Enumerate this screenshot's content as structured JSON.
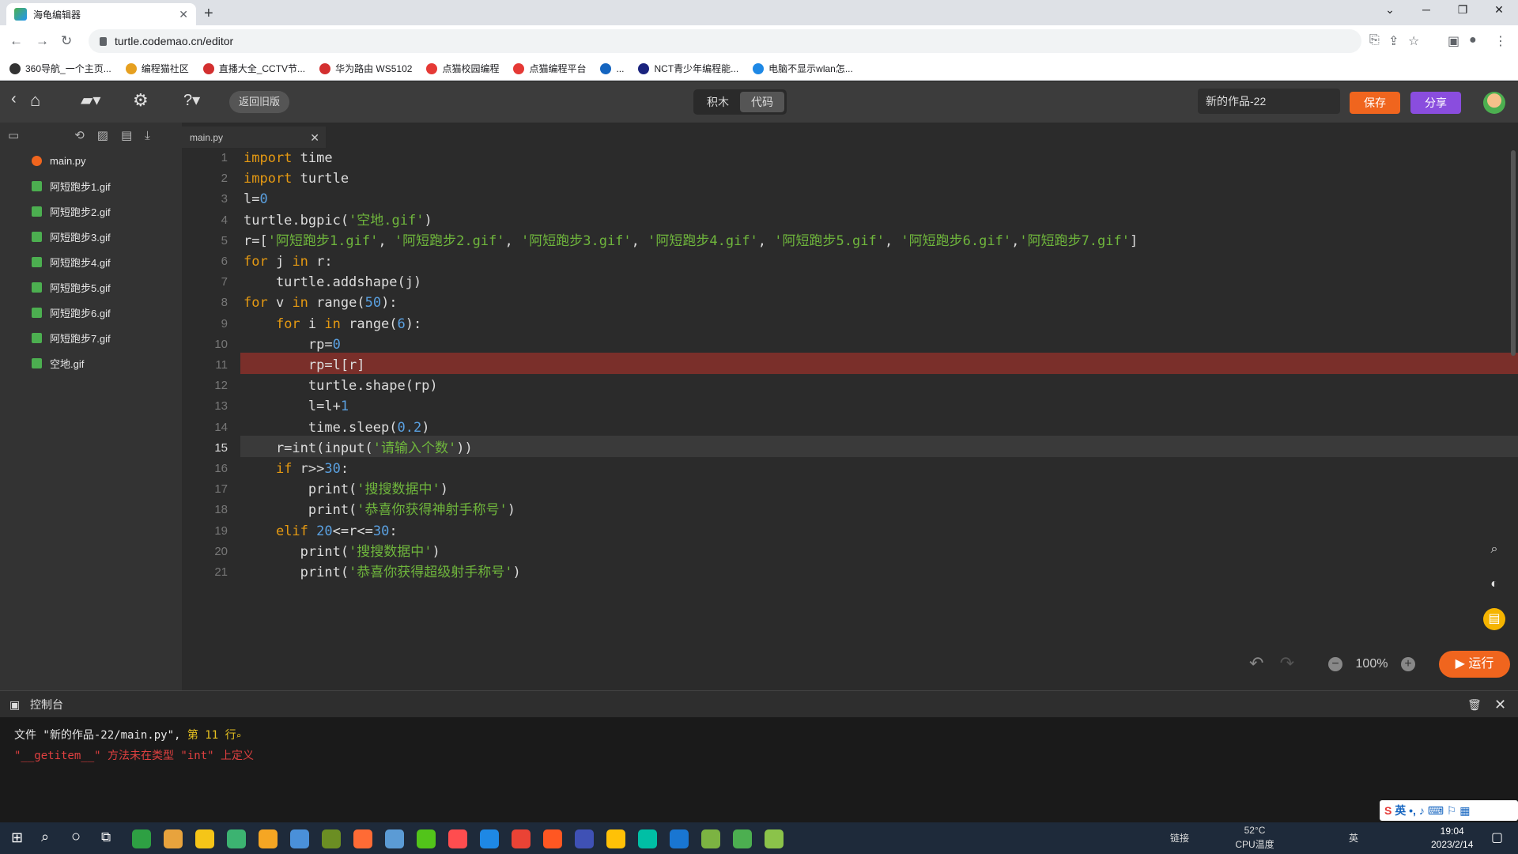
{
  "browser": {
    "tab_title": "海龟编辑器",
    "url": "turtle.codemao.cn/editor",
    "bookmarks": [
      {
        "label": "360导航_一个主页...",
        "color": "#333333"
      },
      {
        "label": "编程猫社区",
        "color": "#e6a020"
      },
      {
        "label": "直播大全_CCTV节...",
        "color": "#d32f2f"
      },
      {
        "label": "华为路由 WS5102",
        "color": "#d32f2f"
      },
      {
        "label": "点猫校园编程",
        "color": "#e53935"
      },
      {
        "label": "点猫编程平台",
        "color": "#e53935"
      },
      {
        "label": "...",
        "color": "#1565c0"
      },
      {
        "label": "NCT青少年编程能...",
        "color": "#1a237e"
      },
      {
        "label": "电脑不显示wlan怎...",
        "color": "#1e88e5"
      }
    ]
  },
  "toolbar": {
    "old_version": "返回旧版",
    "mode_blocks": "积木",
    "mode_code": "代码",
    "project_name": "新的作品-22",
    "save": "保存",
    "share": "分享"
  },
  "files": [
    {
      "name": "main.py",
      "type": "python"
    },
    {
      "name": "阿短跑步1.gif",
      "type": "image"
    },
    {
      "name": "阿短跑步2.gif",
      "type": "image"
    },
    {
      "name": "阿短跑步3.gif",
      "type": "image"
    },
    {
      "name": "阿短跑步4.gif",
      "type": "image"
    },
    {
      "name": "阿短跑步5.gif",
      "type": "image"
    },
    {
      "name": "阿短跑步6.gif",
      "type": "image"
    },
    {
      "name": "阿短跑步7.gif",
      "type": "image"
    },
    {
      "name": "空地.gif",
      "type": "image"
    }
  ],
  "editor_tab": "main.py",
  "code_lines": [
    [
      [
        "kw",
        "import"
      ],
      [
        "p",
        " time"
      ]
    ],
    [
      [
        "kw",
        "import"
      ],
      [
        "p",
        " turtle"
      ]
    ],
    [
      [
        "p",
        "l="
      ],
      [
        "num",
        "0"
      ]
    ],
    [
      [
        "p",
        "turtle.bgpic("
      ],
      [
        "str",
        "'空地.gif'"
      ],
      [
        "p",
        ")"
      ]
    ],
    [
      [
        "p",
        "r=["
      ],
      [
        "str",
        "'阿短跑步1.gif'"
      ],
      [
        "p",
        ", "
      ],
      [
        "str",
        "'阿短跑步2.gif'"
      ],
      [
        "p",
        ", "
      ],
      [
        "str",
        "'阿短跑步3.gif'"
      ],
      [
        "p",
        ", "
      ],
      [
        "str",
        "'阿短跑步4.gif'"
      ],
      [
        "p",
        ", "
      ],
      [
        "str",
        "'阿短跑步5.gif'"
      ],
      [
        "p",
        ", "
      ],
      [
        "str",
        "'阿短跑步6.gif'"
      ],
      [
        "p",
        ","
      ],
      [
        "str",
        "'阿短跑步7.gif'"
      ],
      [
        "p",
        "]"
      ]
    ],
    [
      [
        "kw",
        "for"
      ],
      [
        "p",
        " j "
      ],
      [
        "kw",
        "in"
      ],
      [
        "p",
        " r:"
      ]
    ],
    [
      [
        "p",
        "    turtle.addshape(j)"
      ]
    ],
    [
      [
        "kw",
        "for"
      ],
      [
        "p",
        " v "
      ],
      [
        "kw",
        "in"
      ],
      [
        "p",
        " range("
      ],
      [
        "num",
        "50"
      ],
      [
        "p",
        "):"
      ]
    ],
    [
      [
        "p",
        "    "
      ],
      [
        "kw",
        "for"
      ],
      [
        "p",
        " i "
      ],
      [
        "kw",
        "in"
      ],
      [
        "p",
        " range("
      ],
      [
        "num",
        "6"
      ],
      [
        "p",
        "):"
      ]
    ],
    [
      [
        "p",
        "        rp="
      ],
      [
        "num",
        "0"
      ]
    ],
    [
      [
        "p",
        "        rp=l[r]"
      ]
    ],
    [
      [
        "p",
        "        turtle.shape(rp)"
      ]
    ],
    [
      [
        "p",
        "        l=l+"
      ],
      [
        "num",
        "1"
      ]
    ],
    [
      [
        "p",
        "        time.sleep("
      ],
      [
        "num",
        "0.2"
      ],
      [
        "p",
        ")"
      ]
    ],
    [
      [
        "p",
        "    r=int(input("
      ],
      [
        "str",
        "'请输入个数'"
      ],
      [
        "p",
        "))"
      ]
    ],
    [
      [
        "p",
        "    "
      ],
      [
        "kw",
        "if"
      ],
      [
        "p",
        " r>>"
      ],
      [
        "num",
        "30"
      ],
      [
        "p",
        ":"
      ]
    ],
    [
      [
        "p",
        "        print("
      ],
      [
        "str",
        "'搜搜数据中'"
      ],
      [
        "p",
        ")"
      ]
    ],
    [
      [
        "p",
        "        print("
      ],
      [
        "str",
        "'恭喜你获得神射手称号'"
      ],
      [
        "p",
        ")"
      ]
    ],
    [
      [
        "p",
        "    "
      ],
      [
        "kw",
        "elif"
      ],
      [
        "p",
        " "
      ],
      [
        "num",
        "20"
      ],
      [
        "p",
        "<=r<="
      ],
      [
        "num",
        "30"
      ],
      [
        "p",
        ":"
      ]
    ],
    [
      [
        "p",
        "       print("
      ],
      [
        "str",
        "'搜搜数据中'"
      ],
      [
        "p",
        ")"
      ]
    ],
    [
      [
        "p",
        "       print("
      ],
      [
        "str",
        "'恭喜你获得超级射手称号'"
      ],
      [
        "p",
        ")"
      ]
    ]
  ],
  "error_line": 11,
  "current_line": 15,
  "zoom": "100%",
  "run": "运行",
  "console": {
    "title": "控制台",
    "line1_prefix": "文件 \"新的作品-22/main.py\", ",
    "line1_loc": "第 11 行",
    "line2": "\"__getitem__\" 方法未在类型 \"int\" 上定义"
  },
  "taskbar": {
    "net": "链接",
    "temp": "52°C",
    "temp_label": "CPU温度",
    "ime": "英",
    "time": "19:04",
    "date": "2023/2/14",
    "apps": [
      "#2ea043",
      "#e8a33d",
      "#f5c518",
      "#3cb371",
      "#f5a623",
      "#4a90d9",
      "#6b8e23",
      "#ff6b35",
      "#5b9bd5",
      "#52c41a",
      "#ff4d4f",
      "#1e88e5",
      "#ea4335",
      "#ff5722",
      "#3f51b5",
      "#ffc107",
      "#00bfa5",
      "#1976d2",
      "#7cb342",
      "#4caf50",
      "#8bc34a"
    ]
  },
  "colors": {
    "accent": "#f0651e",
    "share": "#8a4dde",
    "error_row": "#7a2f2a",
    "current_row": "#3a3a3a"
  }
}
